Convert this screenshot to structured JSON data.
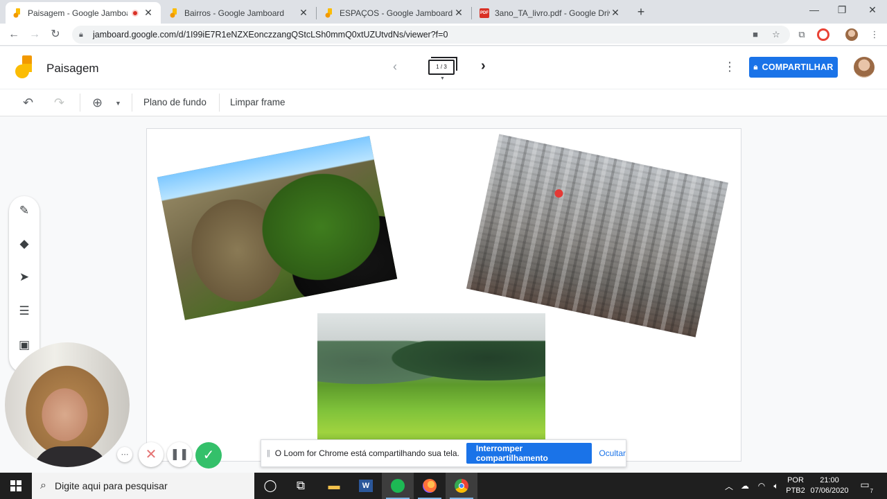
{
  "browser": {
    "tabs": [
      {
        "label": "Paisagem - Google Jamboard",
        "active": true,
        "recording": true
      },
      {
        "label": "Bairros - Google Jamboard",
        "active": false
      },
      {
        "label": "ESPAÇOS - Google Jamboard",
        "active": false
      },
      {
        "label": "3ano_TA_livro.pdf - Google Drive",
        "active": false
      }
    ],
    "url": "jamboard.google.com/d/1I99iE7R1eNZXEonczzangQStcLSh0mmQ0xtUZUtvdNs/viewer?f=0",
    "pdf_favicon_text": "PDF"
  },
  "jamboard": {
    "title": "Paisagem",
    "frame_indicator": "1 / 3",
    "share_label": "COMPARTILHAR",
    "actions": {
      "background_label": "Plano de fundo",
      "clear_frame_label": "Limpar frame"
    },
    "tools": [
      "pen-icon",
      "eraser-icon",
      "select-arrow-icon",
      "sticky-note-icon",
      "image-icon"
    ]
  },
  "loom": {
    "sharing_message": "O Loom for Chrome está compartilhando sua tela.",
    "stop_label": "Interromper compartilhamento",
    "hide_label": "Ocultar"
  },
  "taskbar": {
    "search_placeholder": "Digite aqui para pesquisar",
    "language_top": "POR",
    "language_bottom": "PTB2",
    "time": "21:00",
    "date": "07/06/2020",
    "notification_count": "7"
  },
  "colors": {
    "primary": "#1a73e8",
    "jamboard_yellow": "#fbbc04",
    "loom_green": "#34c06a",
    "record_red": "#d93025"
  }
}
